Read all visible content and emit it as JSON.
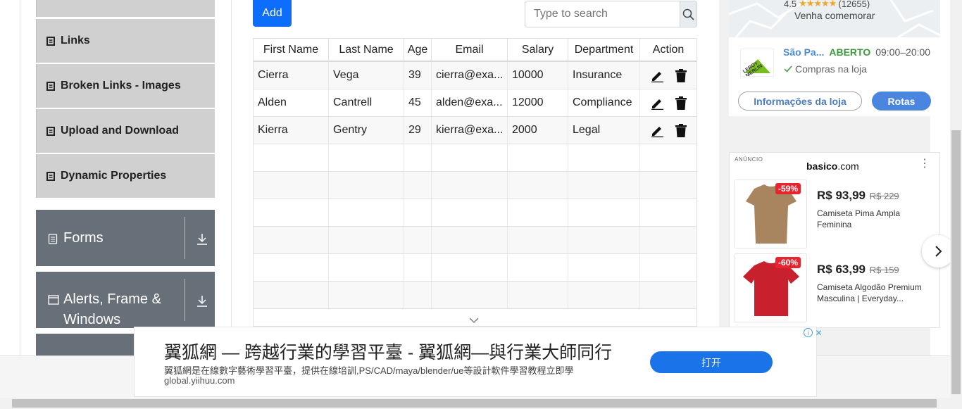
{
  "sidebar": {
    "items": [
      {
        "label": "Links"
      },
      {
        "label": "Broken Links - Images"
      },
      {
        "label": "Upload and Download"
      },
      {
        "label": "Dynamic Properties"
      }
    ],
    "groups": [
      {
        "label": "Forms"
      },
      {
        "label_line1": "Alerts, Frame &",
        "label_line2": "Windows"
      }
    ]
  },
  "toolbar": {
    "add_label": "Add",
    "search_placeholder": "Type to search"
  },
  "table": {
    "headers": [
      "First Name",
      "Last Name",
      "Age",
      "Email",
      "Salary",
      "Department",
      "Action"
    ],
    "rows": [
      {
        "first": "Cierra",
        "last": "Vega",
        "age": "39",
        "email": "cierra@exa...",
        "salary": "10000",
        "dept": "Insurance"
      },
      {
        "first": "Alden",
        "last": "Cantrell",
        "age": "45",
        "email": "alden@exa...",
        "salary": "12000",
        "dept": "Compliance"
      },
      {
        "first": "Kierra",
        "last": "Gentry",
        "age": "29",
        "email": "kierra@exa...",
        "salary": "2000",
        "dept": "Legal"
      }
    ]
  },
  "store_ad": {
    "rating": "4.5",
    "reviews": "(12655)",
    "tagline": "Venha comemorar",
    "store_name": "São Pa...",
    "status": "ABERTO",
    "hours": "09:00–20:00",
    "feature": "Compras na loja",
    "info_button": "Informações da loja",
    "route_button": "Rotas"
  },
  "product_ad": {
    "ad_label": "ANÚNCIO",
    "brand_prefix": "basico",
    "brand_suffix": ".com",
    "products": [
      {
        "discount": "-59%",
        "price": "R$ 93,99",
        "old_price": "R$ 229",
        "title": "Camiseta Pima Ampla Feminina",
        "color": "#a8845f"
      },
      {
        "discount": "-60%",
        "price": "R$ 63,99",
        "old_price": "R$ 159",
        "title": "Camiseta Algodão Premium Masculina | Everyday...",
        "color": "#c8202c"
      }
    ]
  },
  "banner": {
    "headline": "翼狐網 — 跨越行業的學習平臺 - 翼狐網—與行業大師同行",
    "description": "翼狐網是在線數字藝術學習平臺，提供在線培訓,PS/CAD/maya/blender/ue等設計軟件學習教程立即學",
    "domain": "global.yiihuu.com",
    "open_label": "打开"
  }
}
